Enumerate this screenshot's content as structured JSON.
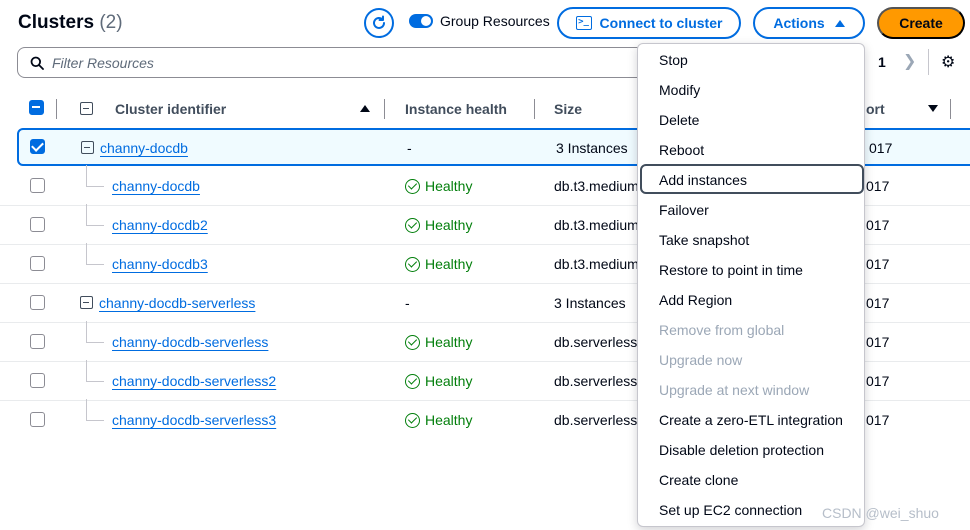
{
  "header": {
    "title": "Clusters",
    "count": "(2)",
    "group_resources_label": "Group Resources",
    "connect_label": "Connect to cluster",
    "actions_label": "Actions",
    "create_label": "Create"
  },
  "filter": {
    "placeholder": "Filter Resources"
  },
  "pagination": {
    "page": "1"
  },
  "table": {
    "columns": {
      "cluster_identifier": "Cluster identifier",
      "instance_health": "Instance health",
      "size": "Size",
      "port_partial": "ort"
    },
    "rows": [
      {
        "id": "channy-docdb",
        "health": "-",
        "size": "3 Instances",
        "port": "017"
      },
      {
        "id": "channy-docdb",
        "health": "Healthy",
        "size": "db.t3.medium",
        "port": "017"
      },
      {
        "id": "channy-docdb2",
        "health": "Healthy",
        "size": "db.t3.medium",
        "port": "017"
      },
      {
        "id": "channy-docdb3",
        "health": "Healthy",
        "size": "db.t3.medium",
        "port": "017"
      },
      {
        "id": "channy-docdb-serverless",
        "health": "-",
        "size": "3 Instances",
        "port": "017"
      },
      {
        "id": "channy-docdb-serverless",
        "health": "Healthy",
        "size": "db.serverless",
        "port": "017"
      },
      {
        "id": "channy-docdb-serverless2",
        "health": "Healthy",
        "size": "db.serverless",
        "port": "017"
      },
      {
        "id": "channy-docdb-serverless3",
        "health": "Healthy",
        "size": "db.serverless",
        "port": "017"
      }
    ]
  },
  "actions_menu": {
    "items": [
      {
        "label": "Stop",
        "enabled": true
      },
      {
        "label": "Modify",
        "enabled": true
      },
      {
        "label": "Delete",
        "enabled": true
      },
      {
        "label": "Reboot",
        "enabled": true
      },
      {
        "label": "Add instances",
        "enabled": true,
        "focused": true
      },
      {
        "label": "Failover",
        "enabled": true
      },
      {
        "label": "Take snapshot",
        "enabled": true
      },
      {
        "label": "Restore to point in time",
        "enabled": true
      },
      {
        "label": "Add Region",
        "enabled": true
      },
      {
        "label": "Remove from global",
        "enabled": false
      },
      {
        "label": "Upgrade now",
        "enabled": false
      },
      {
        "label": "Upgrade at next window",
        "enabled": false
      },
      {
        "label": "Create a zero-ETL integration",
        "enabled": true
      },
      {
        "label": "Disable deletion protection",
        "enabled": true
      },
      {
        "label": "Create clone",
        "enabled": true
      },
      {
        "label": "Set up EC2 connection",
        "enabled": true
      }
    ]
  },
  "watermark": "CSDN @wei_shuo",
  "colors": {
    "accent": "#006ce0",
    "primary_button": "#ff9900",
    "healthy": "#037f0c",
    "disabled_text": "#9ba7b6"
  }
}
